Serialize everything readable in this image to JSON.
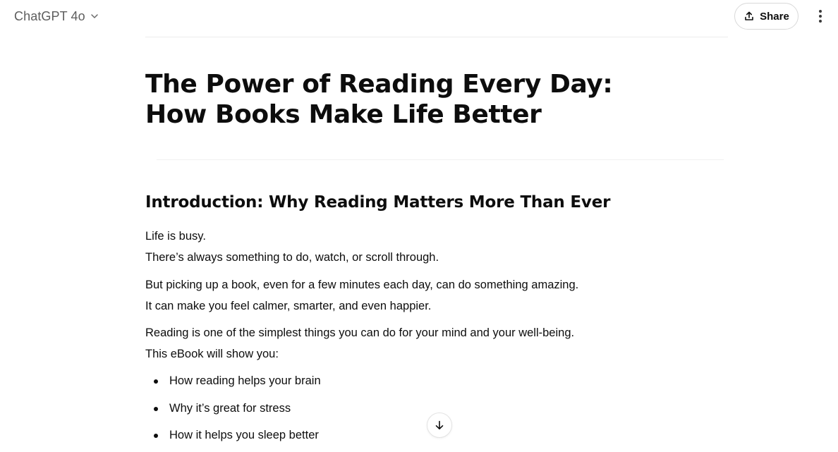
{
  "header": {
    "model_name": "ChatGPT 4o",
    "share_label": "Share"
  },
  "article": {
    "title": "The Power of Reading Every Day: How Books Make Life Better",
    "section_heading": "Introduction: Why Reading Matters More Than Ever",
    "paragraphs": [
      "Life is busy.",
      "There’s always something to do, watch, or scroll through.",
      "But picking up a book, even for a few minutes each day, can do something amazing.",
      "It can make you feel calmer, smarter, and even happier.",
      "Reading is one of the simplest things you can do for your mind and your well-being.",
      "This eBook will show you:"
    ],
    "bullets": [
      "How reading helps your brain",
      "Why it’s great for stress",
      "How it helps you sleep better"
    ]
  },
  "icons": {
    "model_chevron": "chevron-down-icon",
    "share": "upload-icon",
    "more": "more-vertical-icon",
    "scroll_down": "arrow-down-icon"
  }
}
